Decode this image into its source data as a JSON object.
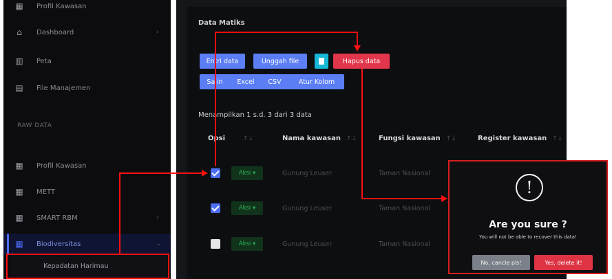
{
  "sidebar": {
    "items": [
      {
        "icon": "grid-icon",
        "label": "Profil Kawasan"
      },
      {
        "icon": "home-icon",
        "label": "Dashboard"
      },
      {
        "icon": "map-icon",
        "label": "Peta"
      },
      {
        "icon": "archive-icon",
        "label": "File Manajemen"
      }
    ],
    "section": "RAW DATA",
    "raw_items": [
      {
        "icon": "grid-icon",
        "label": "Profil Kawasan"
      },
      {
        "icon": "grid-icon",
        "label": "METT"
      },
      {
        "icon": "grid-icon",
        "label": "SMART RBM"
      },
      {
        "icon": "grid-icon",
        "label": "Biodiversitas"
      }
    ],
    "sub_item": "Kepadatan Harimau",
    "colors": {
      "active": "#4c6ef5"
    }
  },
  "card": {
    "title": "Data Matiks",
    "toolbar": {
      "entri": "Entri data",
      "unggah": "Unggah file",
      "hapus": "Hapus data",
      "salin": "Salin",
      "excel": "Excel",
      "csv": "CSV",
      "atur": "Atur Kolom"
    },
    "showing": "Menampilkan 1 s.d. 3 dari 3 data",
    "columns": [
      "Opsi",
      "Nama kawasan",
      "Fungsi kawasan",
      "Register kawasan"
    ],
    "sort_glyph": "↑↓",
    "rows": [
      {
        "checked": true,
        "aksi": "Aksi ▾",
        "nama": "Gunung Leuser",
        "fungsi": "Taman Nasional"
      },
      {
        "checked": true,
        "aksi": "Aksi ▾",
        "nama": "Gunung Leuser",
        "fungsi": "Taman Nasional"
      },
      {
        "checked": false,
        "aksi": "Aksi ▾",
        "nama": "Gunung Leuser",
        "fungsi": "Taman Nasional"
      }
    ]
  },
  "dialog": {
    "icon": "!",
    "title": "Are you sure ?",
    "text": "You will not be able to recover this data!",
    "cancel": "No, cancle pls!",
    "confirm": "Yes, delete it!"
  }
}
